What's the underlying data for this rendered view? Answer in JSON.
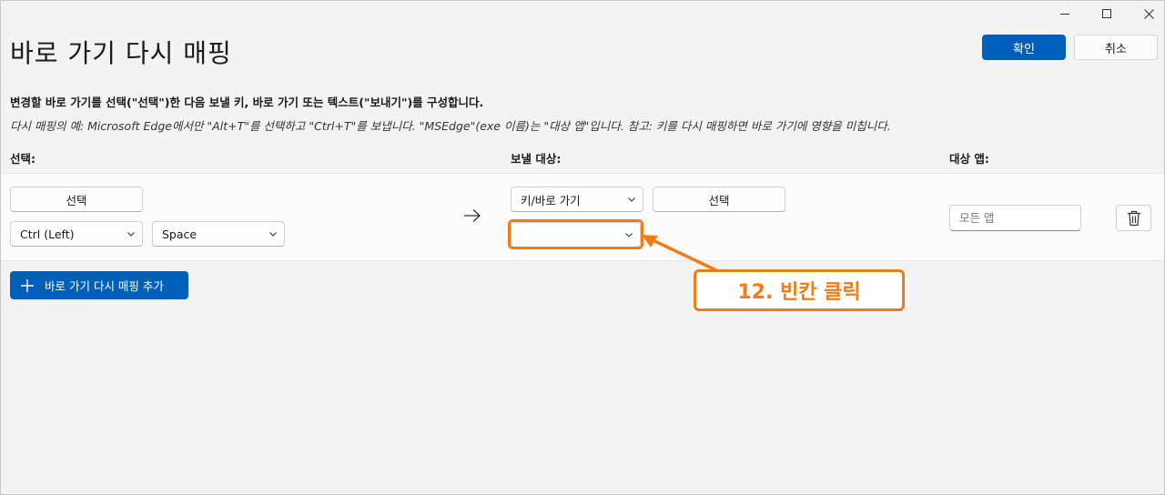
{
  "window": {
    "controls": {
      "minimize": "minimize-icon",
      "maximize": "maximize-icon",
      "close": "close-icon"
    }
  },
  "header": {
    "title": "바로 가기 다시 매핑",
    "confirm_label": "확인",
    "cancel_label": "취소"
  },
  "instructions": "변경할 바로 가기를 선택(\"선택\")한 다음 보낼 키, 바로 가기 또는 텍스트(\"보내기\")를 구성합니다.",
  "example": "다시 매핑의 예: Microsoft Edge에서만 \"Alt+T\"를 선택하고 \"Ctrl+T\"를 보냅니다. \"MSEdge\"(exe 이름)는 \"대상 앱\"입니다. 참고: 키를 다시 매핑하면 바로 가기에 영향을 미칩니다.",
  "columns": {
    "select": "선택:",
    "send_to": "보낼 대상:",
    "target_app": "대상 앱:"
  },
  "row": {
    "select_button": "선택",
    "modifier_value": "Ctrl (Left)",
    "key_value": "Space",
    "send_type_value": "키/바로 가기",
    "send_select_button": "선택",
    "send_key_value": "",
    "app_placeholder": "모든 앱"
  },
  "add_button_label": "바로 가기 다시 매핑 추가",
  "annotation": {
    "text": "12. 빈칸 클릭",
    "color": "#f07c16"
  },
  "colors": {
    "accent": "#005fb8",
    "background": "#f3f3f3"
  }
}
